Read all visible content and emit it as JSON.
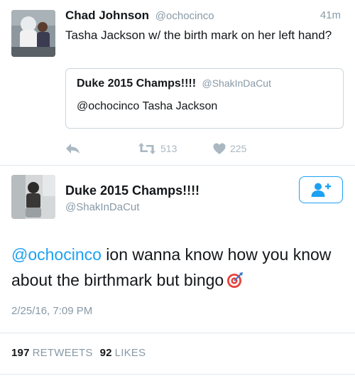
{
  "tweet": {
    "author_name": "Chad Johnson",
    "author_handle": "@ochocinco",
    "time": "41m",
    "text": "Tasha Jackson w/ the birth mark on her left hand?",
    "quoted": {
      "author_name": "Duke 2015 Champs!!!!",
      "author_handle": "@ShakInDaCut",
      "text": "@ochocinco Tasha Jackson"
    },
    "actions": {
      "reply_icon": "reply-icon",
      "retweet_icon": "retweet-icon",
      "retweet_count": "513",
      "like_icon": "heart-icon",
      "like_count": "225"
    }
  },
  "reply": {
    "author_name": "Duke 2015 Champs!!!!",
    "author_handle": "@ShakInDaCut",
    "follow_icon": "add-user-icon",
    "mention": "@ochocinco",
    "text_rest": " ion wanna know how you know about the birthmark but bingo",
    "emoji": "bullseye-emoji",
    "date": "2/25/16, 7:09 PM",
    "retweets_count": "197",
    "retweets_label": "RETWEETS",
    "likes_count": "92",
    "likes_label": "LIKES"
  },
  "colors": {
    "accent": "#1da1f2",
    "muted": "#8899a6",
    "text": "#14171a",
    "border": "#e1e8ed"
  }
}
